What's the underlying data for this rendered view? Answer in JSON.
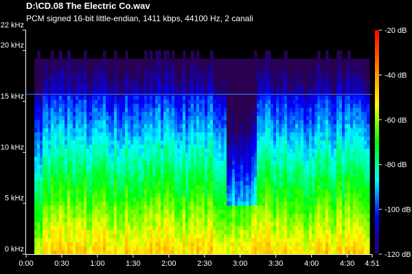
{
  "header": {
    "file_title": "D:\\CD.08  The Electric Co.wav",
    "format_info": "PCM signed 16-bit little-endian, 1411 kbps, 44100 Hz, 2 canali"
  },
  "chart_data": {
    "type": "heatmap",
    "title": "D:\\CD.08  The Electric Co.wav",
    "subtitle": "PCM signed 16-bit little-endian, 1411 kbps, 44100 Hz, 2 canali",
    "x_axis": {
      "unit": "seconds",
      "range": [
        0,
        291
      ],
      "ticks": [
        {
          "value": 0,
          "label": "0:00"
        },
        {
          "value": 30,
          "label": "0:30"
        },
        {
          "value": 60,
          "label": "1:00"
        },
        {
          "value": 90,
          "label": "1:30"
        },
        {
          "value": 120,
          "label": "2:00"
        },
        {
          "value": 150,
          "label": "2:30"
        },
        {
          "value": 180,
          "label": "3:00"
        },
        {
          "value": 210,
          "label": "3:30"
        },
        {
          "value": 240,
          "label": "4:00"
        },
        {
          "value": 270,
          "label": "4:30"
        },
        {
          "value": 291,
          "label": "4:51"
        }
      ]
    },
    "y_axis": {
      "unit": "kHz",
      "range": [
        0,
        22
      ],
      "ticks": [
        {
          "value": 0,
          "label": "0 kHz"
        },
        {
          "value": 5,
          "label": "5 kHz"
        },
        {
          "value": 10,
          "label": "10 kHz"
        },
        {
          "value": 15,
          "label": "15 kHz"
        },
        {
          "value": 20,
          "label": "20 kHz"
        },
        {
          "value": 22,
          "label": "22 kHz"
        }
      ]
    },
    "colorbar": {
      "unit": "dB",
      "range": [
        -120,
        -20
      ],
      "ticks": [
        {
          "value": -20,
          "label": "-20 dB"
        },
        {
          "value": -40,
          "label": "-40 dB"
        },
        {
          "value": -60,
          "label": "-60 dB"
        },
        {
          "value": -80,
          "label": "-80 dB"
        },
        {
          "value": -100,
          "label": "-100 dB"
        },
        {
          "value": -120,
          "label": "-120 dB"
        }
      ],
      "colors": [
        "#ff0000",
        "#ff7f00",
        "#ffff00",
        "#00ff00",
        "#00ffff",
        "#0000ff",
        "#2a0050"
      ]
    },
    "spectrum": {
      "lowpass_cutoff_khz": 19.2,
      "max_content_khz": 20.0,
      "lowpass_line_khz": 15.7,
      "quiet_segment_seconds": [
        168,
        195
      ]
    },
    "grid": false
  }
}
